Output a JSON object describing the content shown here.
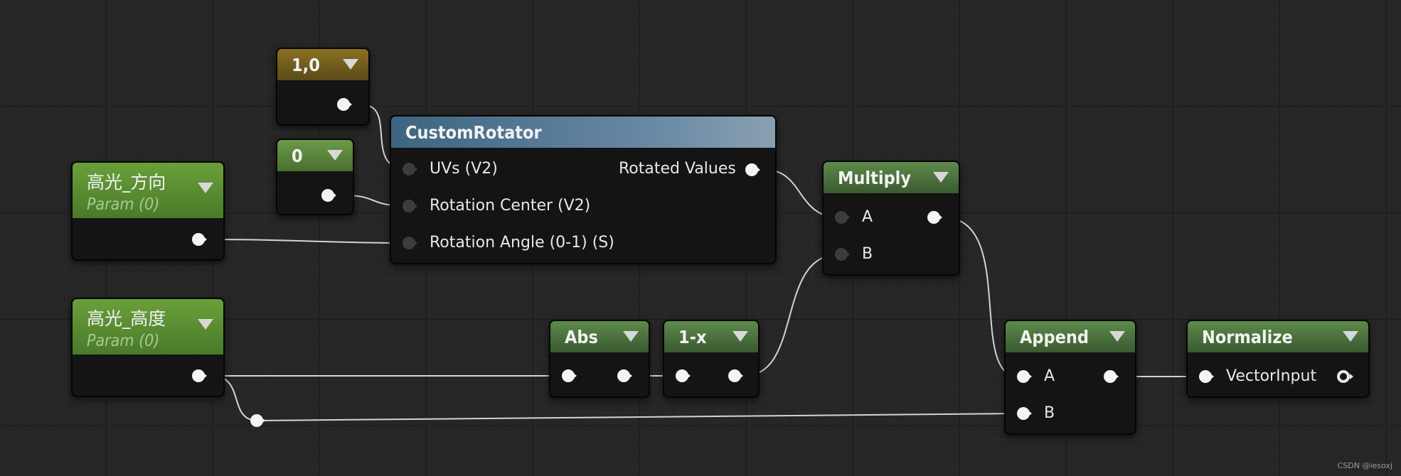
{
  "nodes": {
    "const_10": {
      "title": "1,0"
    },
    "const_0": {
      "title": "0"
    },
    "param_dir": {
      "title": "高光_方向",
      "subtitle": "Param (0)"
    },
    "param_height": {
      "title": "高光_高度",
      "subtitle": "Param (0)"
    },
    "custom_rotator": {
      "title": "CustomRotator",
      "inputs": [
        "UVs (V2)",
        "Rotation Center (V2)",
        "Rotation Angle (0-1) (S)"
      ],
      "output": "Rotated Values"
    },
    "multiply": {
      "title": "Multiply",
      "inputs": [
        "A",
        "B"
      ]
    },
    "abs": {
      "title": "Abs"
    },
    "one_minus": {
      "title": "1-x"
    },
    "append": {
      "title": "Append",
      "inputs": [
        "A",
        "B"
      ]
    },
    "normalize": {
      "title": "Normalize",
      "input": "VectorInput"
    }
  },
  "watermark": "CSDN @iesoxj",
  "colors": {
    "wire": "#d8d8d8",
    "pin": "#f4f4f4",
    "pin_unconnected": "#3c3c3c"
  }
}
